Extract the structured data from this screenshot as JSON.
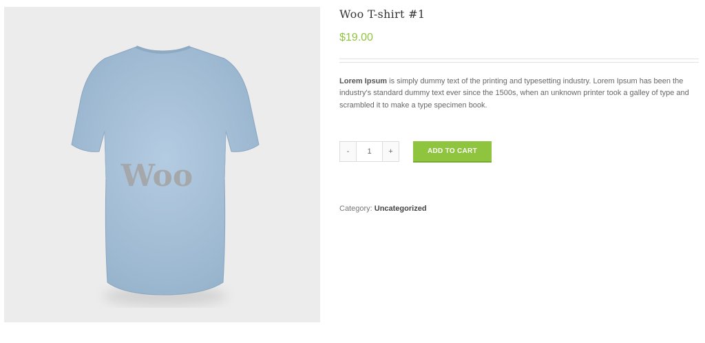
{
  "product": {
    "image_alt": "T-shirt back",
    "image_watermark": "Woo",
    "title": "Woo T-shirt #1",
    "price": "$19.00",
    "description_lead": "Lorem Ipsum",
    "description_rest": " is simply dummy text of the printing and typesetting industry. Lorem Ipsum has been the industry's standard dummy text ever since the 1500s, when an unknown printer took a galley of type and scrambled it to make a type specimen book."
  },
  "cart": {
    "minus_label": "-",
    "quantity": "1",
    "plus_label": "+",
    "add_label": "ADD TO CART"
  },
  "meta": {
    "category_label": "Category: ",
    "category_value": "Uncategorized"
  },
  "colors": {
    "accent": "#8fc53e",
    "shirt": "#a9c3db",
    "panel": "#ececec"
  }
}
